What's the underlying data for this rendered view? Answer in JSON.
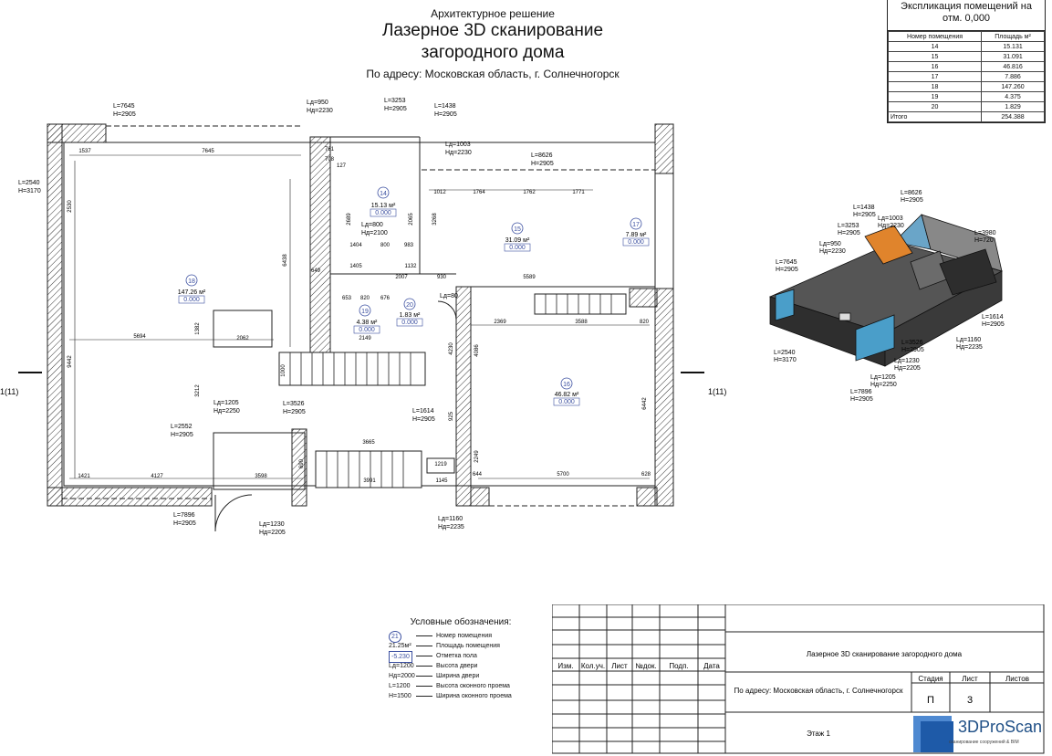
{
  "header": {
    "subtitle": "Архитектурное решение",
    "title_line1": "Лазерное 3D сканирование",
    "title_line2": "загородного дома",
    "address": "По адресу: Московская область, г. Солнечногорск"
  },
  "explication": {
    "caption_line1": "Экспликация помещений на",
    "caption_line2": "отм. 0,000",
    "col_room": "Номер помещения",
    "col_area": "Площадь м²",
    "rows": [
      {
        "room": "14",
        "area": "15.131"
      },
      {
        "room": "15",
        "area": "31.091"
      },
      {
        "room": "16",
        "area": "46.816"
      },
      {
        "room": "17",
        "area": "7.886"
      },
      {
        "room": "18",
        "area": "147.260"
      },
      {
        "room": "19",
        "area": "4.375"
      },
      {
        "room": "20",
        "area": "1.829"
      }
    ],
    "total_label": "Итого",
    "total_value": "254.388"
  },
  "plan": {
    "rooms": [
      {
        "num": "14",
        "area": "15.13 м²",
        "level": "0.000"
      },
      {
        "num": "15",
        "area": "31.09 м²",
        "level": "0.000"
      },
      {
        "num": "16",
        "area": "46.82 м²",
        "level": "0.000"
      },
      {
        "num": "17",
        "area": "7.89 м²",
        "level": "0.000"
      },
      {
        "num": "18",
        "area": "147.26 м²",
        "level": "0.000"
      },
      {
        "num": "19",
        "area": "4.38 м²",
        "level": "0.000"
      },
      {
        "num": "20",
        "area": "1.83 м²",
        "level": "0.000"
      }
    ],
    "section_mark": "1(11)",
    "window_labels": {
      "w7645": [
        "L=7645",
        "H=2905"
      ],
      "w3253": [
        "L=3253",
        "H=2905"
      ],
      "w1438": [
        "L=1438",
        "H=2905"
      ],
      "w8626": [
        "L=8626",
        "H=2905"
      ],
      "w2540": [
        "L=2540",
        "H=3170"
      ],
      "w3526": [
        "L=3526",
        "H=2905"
      ],
      "w2552": [
        "L=2552",
        "H=2905"
      ],
      "w1614": [
        "L=1614",
        "H=2905"
      ],
      "w7896": [
        "L=7896",
        "H=2905"
      ]
    },
    "door_labels": {
      "d950": [
        "Lд=950",
        "Hд=2230"
      ],
      "d1003": [
        "Lд=1003",
        "Hд=2230"
      ],
      "d800": [
        "Lд=800",
        "Hд=2100"
      ],
      "d1205": [
        "Lд=1205",
        "Hд=2250"
      ],
      "d1230": [
        "Lд=1230",
        "Hд=2205"
      ],
      "d1160": [
        "Lд=1160",
        "Hд=2235"
      ],
      "d80": [
        "Lд=80"
      ]
    },
    "dims": [
      "1537",
      "7645",
      "761",
      "708",
      "127",
      "1012",
      "1764",
      "1762",
      "1771",
      "2530",
      "6438",
      "2689",
      "2065",
      "3268",
      "1404",
      "800",
      "983",
      "1132",
      "1405",
      "2007",
      "930",
      "5589",
      "653",
      "820",
      "676",
      "649",
      "5694",
      "2062",
      "1382",
      "2149",
      "2369",
      "3588",
      "820",
      "9442",
      "3212",
      "1000",
      "4230",
      "4086",
      "6442",
      "3665",
      "1219",
      "1145",
      "3991",
      "925",
      "2249",
      "5700",
      "1421",
      "4127",
      "3598",
      "690",
      "644",
      "628"
    ]
  },
  "iso_labels": [
    [
      "L=1438",
      "H=2905"
    ],
    [
      "L=8626",
      "H=2905"
    ],
    [
      "Lд=1003",
      "Hд=2230"
    ],
    [
      "L=3253",
      "H=2905"
    ],
    [
      "L=3980",
      "H=720"
    ],
    [
      "Lд=950",
      "Hд=2230"
    ],
    [
      "L=7645",
      "H=2905"
    ],
    [
      "L=1614",
      "H=2905"
    ],
    [
      "Lд=1160",
      "Hд=2235"
    ],
    [
      "L=3526",
      "H=2905"
    ],
    [
      "L=2540",
      "H=3170"
    ],
    [
      "Lд=1230",
      "Hд=2205"
    ],
    [
      "L=7896",
      "H=2905"
    ],
    [
      "Lд=1205",
      "Hд=2250"
    ]
  ],
  "legend": {
    "caption": "Условные обозначения:",
    "rows": [
      {
        "label": "21",
        "desc": "Номер помещения"
      },
      {
        "label": "21.25м²",
        "desc": "Площадь помещения"
      },
      {
        "label": "-5.230",
        "desc": "Отметка пола"
      },
      {
        "label": "Lд=1200",
        "desc": "Высота двери"
      },
      {
        "label": "Hд=2000",
        "desc": "Ширина двери"
      },
      {
        "label": "L=1200",
        "desc": "Высота оконного проема"
      },
      {
        "label": "H=1500",
        "desc": "Ширина оконного проема"
      }
    ]
  },
  "stamp": {
    "cols": [
      "Изм.",
      "Кол.уч.",
      "Лист",
      "№док.",
      "Подп.",
      "Дата"
    ],
    "project": "Лазерное 3D сканирование загородного дома",
    "address": "По адресу: Московская область, г. Солнечногорск",
    "stage_h": "Стадия",
    "sheet_h": "Лист",
    "sheets_h": "Листов",
    "stage": "П",
    "sheet": "3",
    "floor": "Этаж 1"
  },
  "brand": {
    "name": "3DProScan",
    "tagline": "сканирование сооружений & BIM"
  },
  "colors": {
    "wall_hatch": "#333333",
    "glass": "#4a9ec9",
    "brand": "#1f4f86"
  }
}
